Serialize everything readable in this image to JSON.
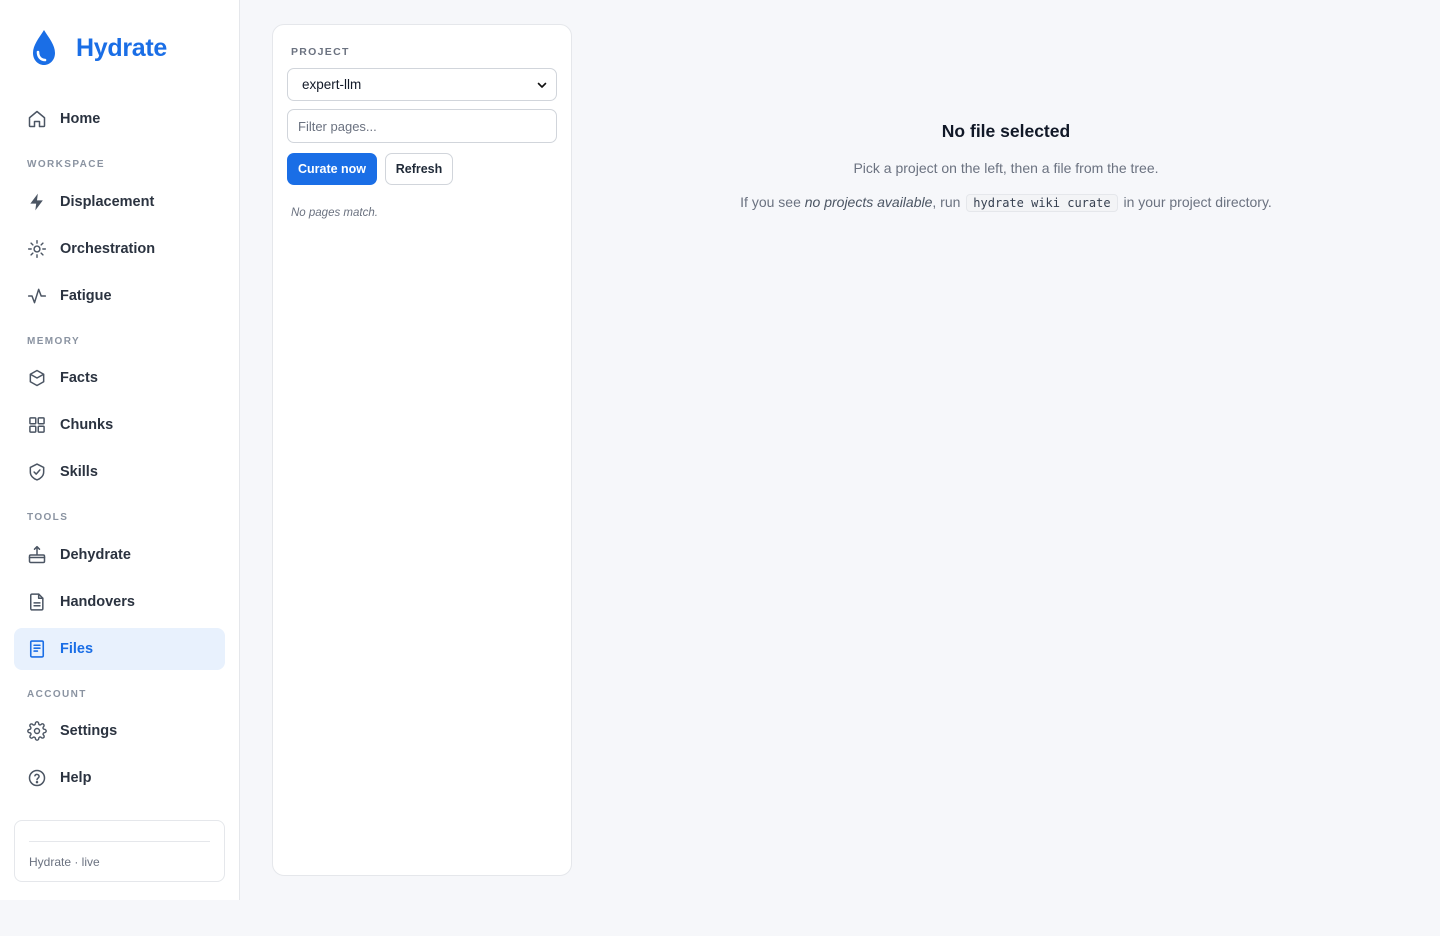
{
  "brand": {
    "name": "Hydrate",
    "color": "#1a6ee6"
  },
  "nav": {
    "home": {
      "label": "Home",
      "icon": "home-icon"
    },
    "sections": {
      "workspace": "WORKSPACE",
      "memory": "MEMORY",
      "tools": "TOOLS",
      "account": "ACCOUNT"
    },
    "items": [
      {
        "label": "Displacement",
        "icon": "bolt-icon"
      },
      {
        "label": "Orchestration",
        "icon": "sun-icon"
      },
      {
        "label": "Fatigue",
        "icon": "activity-icon"
      },
      {
        "label": "Facts",
        "icon": "box-icon"
      },
      {
        "label": "Chunks",
        "icon": "grid-icon"
      },
      {
        "label": "Skills",
        "icon": "shield-check-icon"
      },
      {
        "label": "Dehydrate",
        "icon": "upload-tray-icon"
      },
      {
        "label": "Handovers",
        "icon": "document-icon"
      },
      {
        "label": "Files",
        "icon": "book-icon",
        "active": true
      },
      {
        "label": "Settings",
        "icon": "gear-icon"
      },
      {
        "label": "Help",
        "icon": "help-circle-icon"
      }
    ]
  },
  "status": {
    "text": "Hydrate · live"
  },
  "panel": {
    "project_label": "PROJECT",
    "project_value": "expert-llm",
    "filter_placeholder": "Filter pages...",
    "curate_label": "Curate now",
    "refresh_label": "Refresh",
    "empty_text": "No pages match."
  },
  "main": {
    "title": "No file selected",
    "subtitle": "Pick a project on the left, then a file from the tree.",
    "hint_prefix": "If you see ",
    "hint_em": "no projects available",
    "hint_mid": ", run ",
    "hint_code": "hydrate wiki curate",
    "hint_suffix": " in your project directory."
  }
}
